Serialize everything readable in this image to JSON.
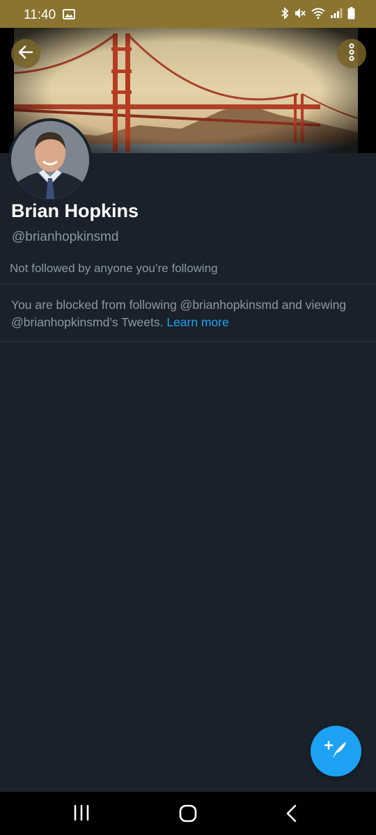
{
  "status_bar": {
    "time": "11:40",
    "icons": [
      "image-icon",
      "bluetooth-icon",
      "mute-icon",
      "wifi-icon",
      "signal-icon",
      "battery-icon"
    ]
  },
  "header": {
    "back_icon": "arrow-left-icon",
    "more_icon": "more-vertical-icon",
    "banner": "golden-gate-bridge-photo"
  },
  "profile": {
    "name": "Brian Hopkins",
    "handle": "@brianhopkinsmd",
    "followed_by": "Not followed by anyone you’re following",
    "blocked_text": "You are blocked from following @brianhopkinsmd and viewing @brianhopkinsmd’s Tweets. ",
    "learn_more": "Learn more"
  },
  "fab": {
    "icon": "compose-tweet-icon"
  },
  "nav_bar": {
    "icons": [
      "recents-icon",
      "home-icon",
      "back-icon"
    ]
  },
  "colors": {
    "background": "#1a212a",
    "status_bar": "#8a7430",
    "accent": "#1da1f2",
    "secondary_text": "#8a98a6",
    "primary_text": "#ffffff"
  }
}
